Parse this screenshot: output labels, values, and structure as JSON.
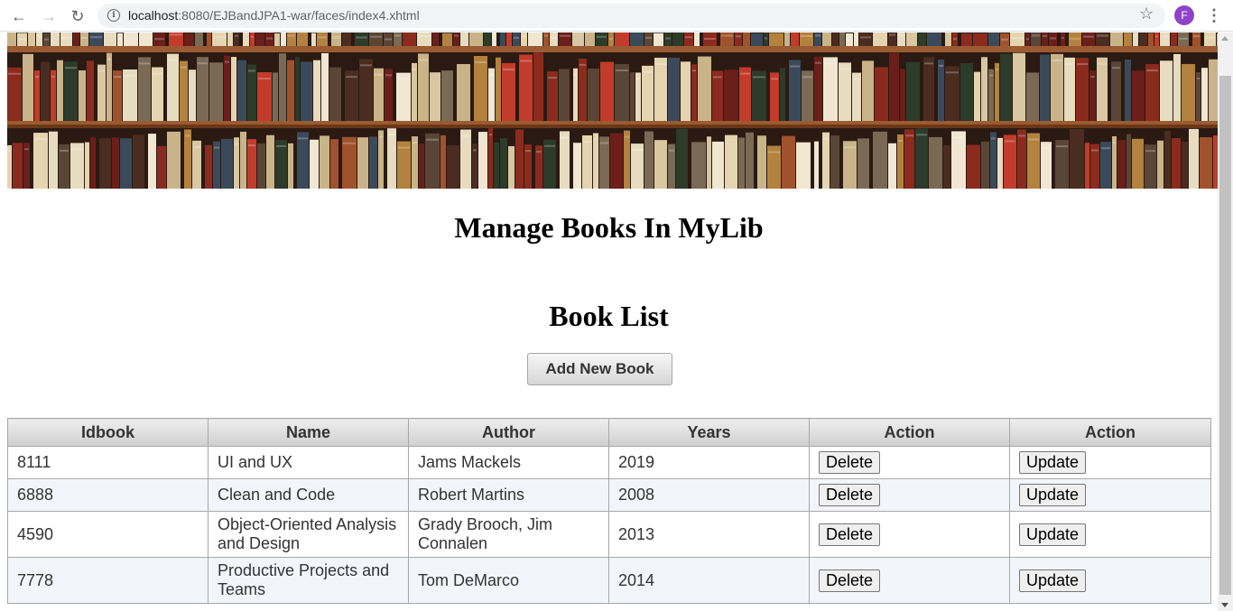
{
  "browser": {
    "url_host": "localhost",
    "url_path": ":8080/EJBandJPA1-war/faces/index4.xhtml",
    "avatar_letter": "F",
    "back_icon": "back-arrow-icon",
    "forward_icon": "forward-arrow-icon",
    "reload_icon": "reload-icon",
    "star_icon": "bookmark-star-icon",
    "menu_icon": "more-vert-icon"
  },
  "page": {
    "title": "Manage Books In MyLib",
    "list_title": "Book List",
    "add_button": "Add New Book"
  },
  "table": {
    "headers": [
      "Idbook",
      "Name",
      "Author",
      "Years",
      "Action",
      "Action"
    ],
    "rows": [
      {
        "id": "8111",
        "name": "UI and UX",
        "author": "Jams Mackels",
        "year": "2019",
        "delete": "Delete",
        "update": "Update"
      },
      {
        "id": "6888",
        "name": "Clean and Code",
        "author": "Robert Martins",
        "year": "2008",
        "delete": "Delete",
        "update": "Update"
      },
      {
        "id": "4590",
        "name": "Object-Oriented Analysis and Design",
        "author": "Grady Brooch, Jim Connalen",
        "year": "2013",
        "delete": "Delete",
        "update": "Update"
      },
      {
        "id": "7778",
        "name": "Productive Projects and Teams",
        "author": "Tom DeMarco",
        "year": "2014",
        "delete": "Delete",
        "update": "Update"
      }
    ]
  },
  "colors": {
    "row_alt": "#f2f5f9",
    "header_gradient_top": "#eeeeee",
    "header_gradient_bottom": "#cfcfcf"
  }
}
